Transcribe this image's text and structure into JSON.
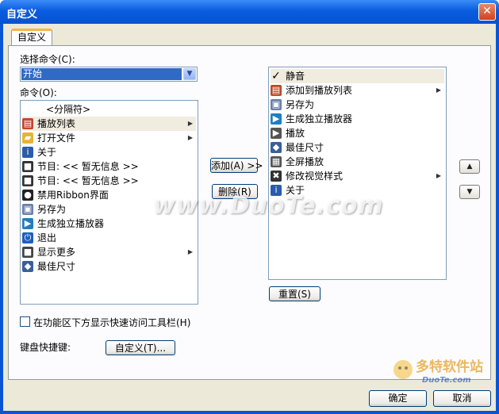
{
  "window": {
    "title": "自定义",
    "close_glyph": "✕"
  },
  "tab": {
    "label": "自定义"
  },
  "choose_command": {
    "label": "选择命令(C):",
    "value": "开始"
  },
  "commands": {
    "label": "命令(O):",
    "items": [
      {
        "label": "<分隔符>",
        "icon": "",
        "arrow": false
      },
      {
        "label": "播放列表",
        "icon": "playlist-icon",
        "arrow": true,
        "selected": true
      },
      {
        "label": "打开文件",
        "icon": "folder-icon",
        "arrow": true
      },
      {
        "label": "关于",
        "icon": "info-icon",
        "arrow": false
      },
      {
        "label": "节目: << 暂无信息 >>",
        "icon": "program-icon",
        "arrow": false
      },
      {
        "label": "节目: << 暂无信息 >>",
        "icon": "program-icon",
        "arrow": false
      },
      {
        "label": "禁用Ribbon界面",
        "icon": "ribbon-icon",
        "arrow": false
      },
      {
        "label": "另存为",
        "icon": "save-icon",
        "arrow": false
      },
      {
        "label": "生成独立播放器",
        "icon": "player-icon",
        "arrow": false
      },
      {
        "label": "退出",
        "icon": "exit-icon",
        "arrow": false
      },
      {
        "label": "显示更多",
        "icon": "more-icon",
        "arrow": true
      },
      {
        "label": "最佳尺寸",
        "icon": "size-icon",
        "arrow": false
      }
    ]
  },
  "add_button": "添加(A) >>",
  "remove_button": "删除(R)",
  "quick_access": {
    "items": [
      {
        "label": "静音",
        "icon": "check-icon",
        "arrow": false,
        "selected": true
      },
      {
        "label": "添加到播放列表",
        "icon": "playlist-icon",
        "arrow": true
      },
      {
        "label": "另存为",
        "icon": "save-icon",
        "arrow": false
      },
      {
        "label": "生成独立播放器",
        "icon": "player-icon",
        "arrow": false
      },
      {
        "label": "播放",
        "icon": "play-icon",
        "arrow": false
      },
      {
        "label": "最佳尺寸",
        "icon": "size-icon",
        "arrow": false
      },
      {
        "label": "全屏播放",
        "icon": "fullscreen-icon",
        "arrow": false
      },
      {
        "label": "修改视觉样式",
        "icon": "style-icon",
        "arrow": true
      },
      {
        "label": "关于",
        "icon": "info-icon",
        "arrow": false
      }
    ]
  },
  "reset_button": "重置(S)",
  "move_up_glyph": "▲",
  "move_down_glyph": "▼",
  "show_below_ribbon": {
    "label": "在功能区下方显示快速访问工具栏(H)",
    "checked": false
  },
  "keyboard": {
    "label": "键盘快捷键:",
    "button": "自定义(T)..."
  },
  "ok_button": "确定",
  "cancel_button": "取消",
  "watermark": {
    "text": "www.DuoTe.com",
    "logo_text": "多特软件站",
    "logo_sub": "DuoTe.com"
  }
}
